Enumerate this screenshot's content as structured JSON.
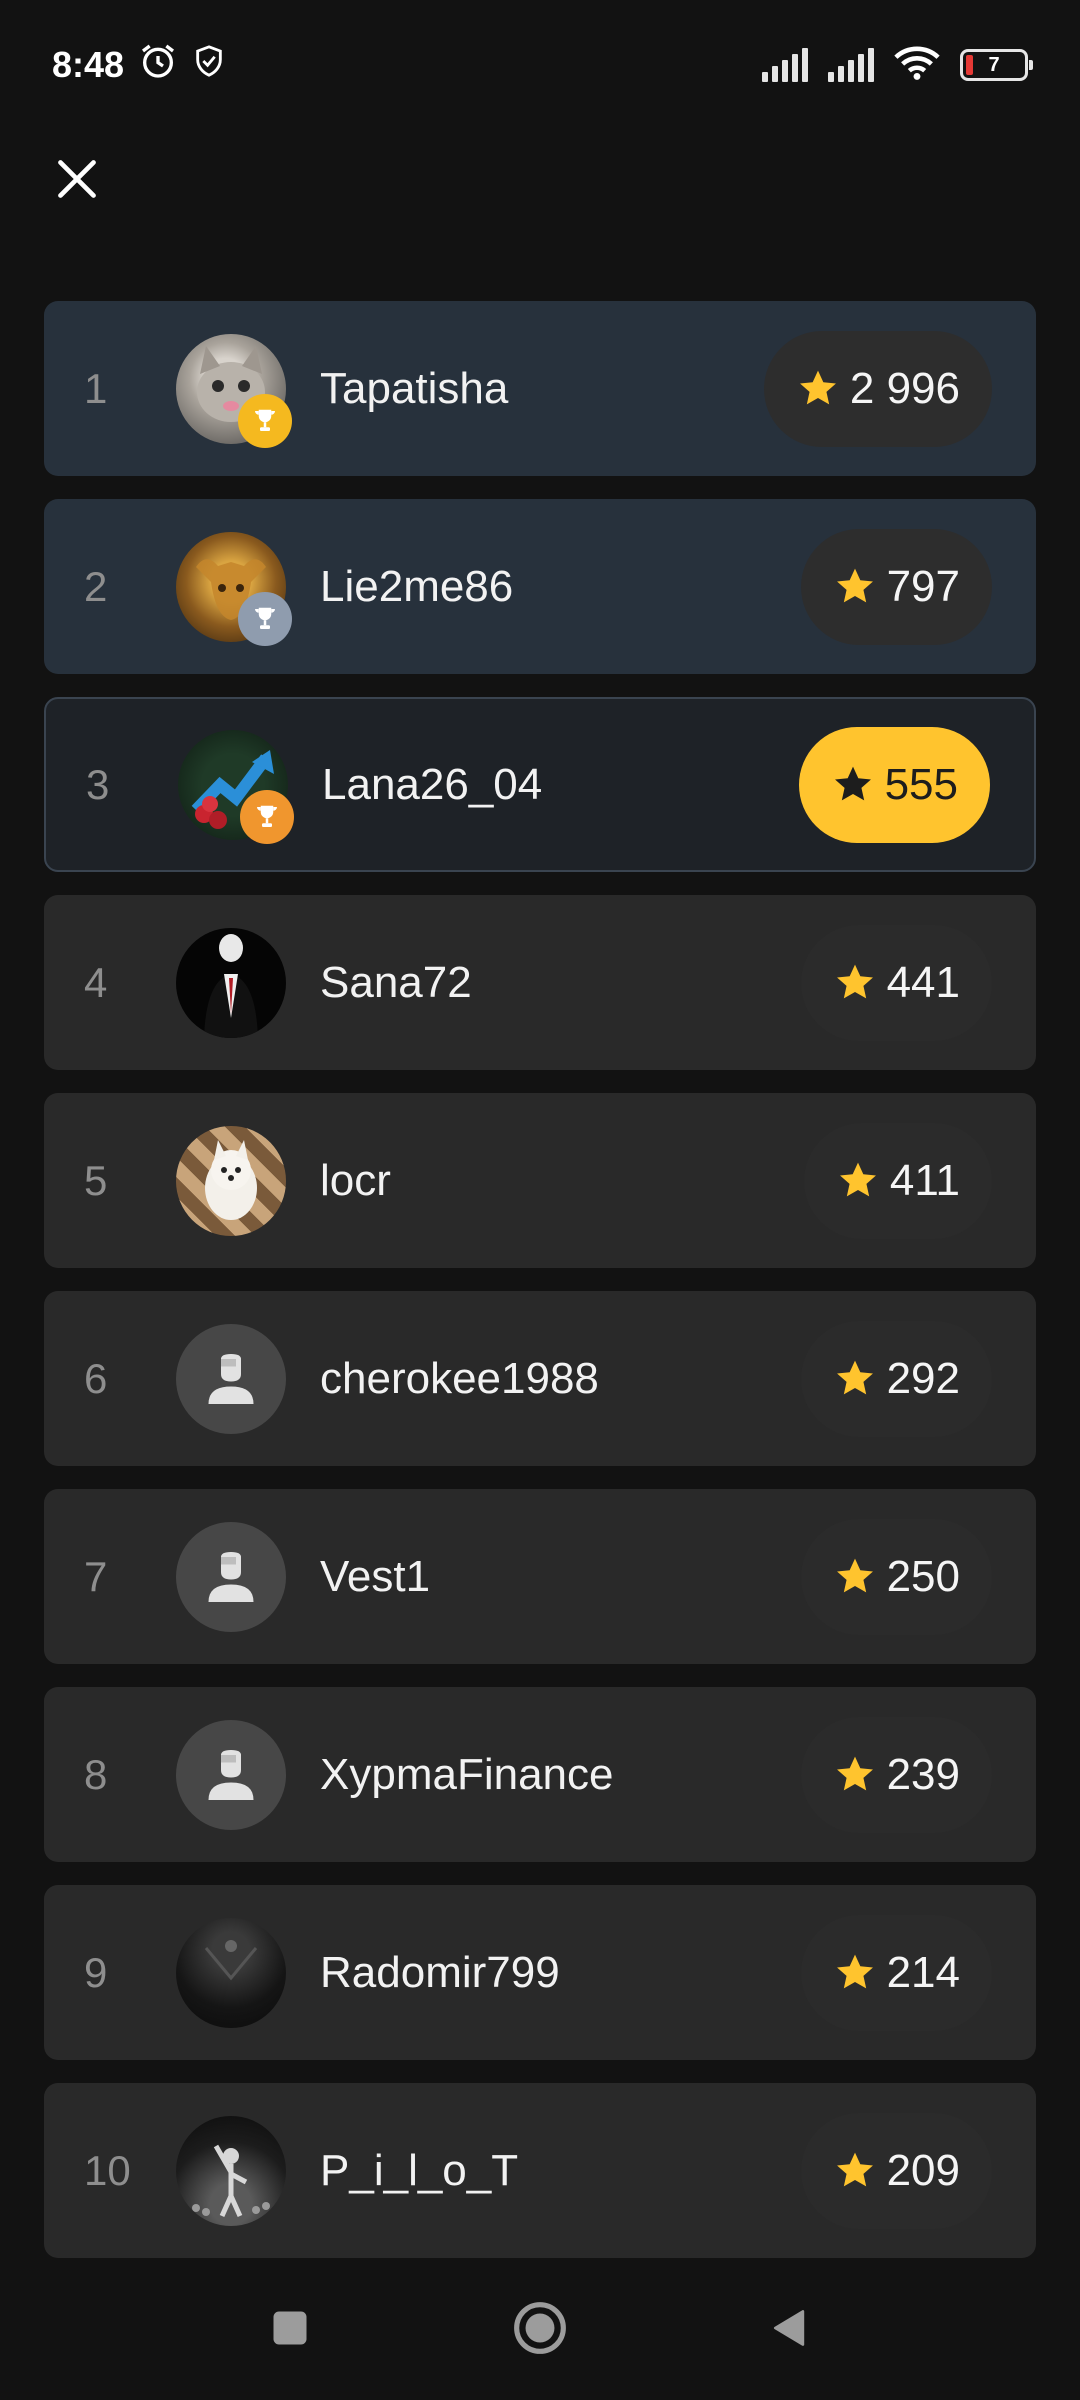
{
  "status": {
    "time": "8:48",
    "battery": "7"
  },
  "icons": {
    "close": "close-icon",
    "star": "star-icon",
    "trophy": "trophy-icon",
    "alarm": "alarm-icon",
    "shield": "shield-icon",
    "wifi": "wifi-icon",
    "signal": "signal-icon",
    "battery": "battery-icon"
  },
  "colors": {
    "background": "#121212",
    "row": "#292929",
    "row_top": "#27313c",
    "accent_star": "#ffc42e",
    "gold": "#f5b91f",
    "silver": "#8f9cae",
    "bronze": "#f0962e"
  },
  "leaderboard": [
    {
      "rank": "1",
      "name": "Tapatisha",
      "score": "2 996"
    },
    {
      "rank": "2",
      "name": "Lie2me86",
      "score": "797"
    },
    {
      "rank": "3",
      "name": "Lana26_04",
      "score": "555"
    },
    {
      "rank": "4",
      "name": "Sana72",
      "score": "441"
    },
    {
      "rank": "5",
      "name": "locr",
      "score": "411"
    },
    {
      "rank": "6",
      "name": "cherokee1988",
      "score": "292"
    },
    {
      "rank": "7",
      "name": "Vest1",
      "score": "250"
    },
    {
      "rank": "8",
      "name": "XypmaFinance",
      "score": "239"
    },
    {
      "rank": "9",
      "name": "Radomir799",
      "score": "214"
    },
    {
      "rank": "10",
      "name": "P_i_l_o_T",
      "score": "209"
    }
  ],
  "navbar": {
    "items": [
      "recents-button",
      "home-button",
      "back-button"
    ]
  }
}
